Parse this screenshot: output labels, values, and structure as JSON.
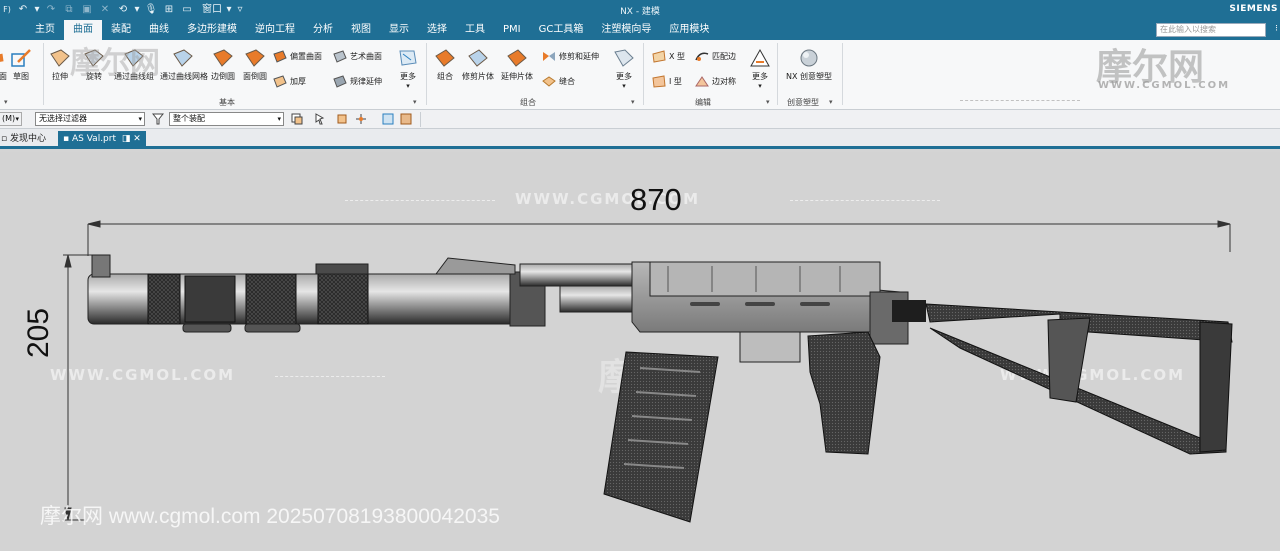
{
  "titlebar": {
    "title": "NX - 建模",
    "brand": "SIEMENS",
    "window_menu": "窗口",
    "left_char": "F)"
  },
  "menubar": {
    "tabs": [
      "主页",
      "曲面",
      "装配",
      "曲线",
      "多边形建模",
      "逆向工程",
      "分析",
      "视图",
      "显示",
      "选择",
      "工具",
      "PMI",
      "GC工具箱",
      "注塑模向导",
      "应用模块"
    ],
    "active": "曲面",
    "search_placeholder": "在此输入以搜索"
  },
  "ribbon": {
    "left_edge": [
      "面",
      "草图"
    ],
    "group1_large": [
      "拉伸",
      "旋转",
      "通过曲线组",
      "通过曲线网格",
      "边倒圆",
      "面倒圆"
    ],
    "group1_small": [
      "偏置曲面",
      "加厚",
      "艺术曲面",
      "规律延伸"
    ],
    "more": "更多",
    "group1_label": "基本",
    "group2_large": [
      "组合",
      "修剪片体",
      "延伸片体"
    ],
    "group2_small": [
      "修剪和延伸",
      "缝合"
    ],
    "group2_label": "组合",
    "group3_small": [
      "X 型",
      "I 型",
      "匹配边",
      "边对称"
    ],
    "group3_label": "编辑",
    "group4_large": [
      "NX 创意塑型"
    ],
    "group4_label": "创意塑型",
    "watermark_logo": "摩尔网",
    "watermark_url": "WWW.CGMOL.COM"
  },
  "toolbar": {
    "menu_label": "(M)",
    "filter": "无选择过滤器",
    "scope": "整个装配"
  },
  "doctabs": {
    "discovery": "发现中心",
    "active": "AS Val.prt"
  },
  "viewport": {
    "dim_length": "870",
    "dim_height": "205",
    "watermark_url": "WWW.CGMOL.COM",
    "watermark_logo": "摩尔网",
    "footer": "摩尔网 www.cgmol.com 20250708193800042035"
  },
  "colors": {
    "titlebar": "#1f6f95",
    "viewport_bg": "#d3d3d3",
    "model_body": "#8a8a8a"
  }
}
